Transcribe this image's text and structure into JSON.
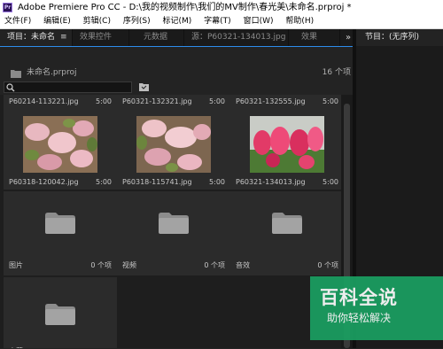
{
  "app": {
    "title": "Adobe Premiere Pro CC - D:\\我的视频制作\\我们的MV制作\\春光美\\未命名.prproj *",
    "icon": "premiere-pro-icon"
  },
  "menu": [
    "文件(F)",
    "编辑(E)",
    "剪辑(C)",
    "序列(S)",
    "标记(M)",
    "字幕(T)",
    "窗口(W)",
    "帮助(H)"
  ],
  "tabs": [
    {
      "label": "项目：未命名",
      "menu": "≡"
    },
    {
      "label": "效果控件"
    },
    {
      "label": "元数据"
    },
    {
      "label": "源：P60321-134013.jpg"
    },
    {
      "label": "效果"
    }
  ],
  "overflow": "»",
  "project": {
    "file": "未命名.prproj",
    "count": "16 个项"
  },
  "search": {
    "placeholder": ""
  },
  "grid": {
    "top_row": [
      {
        "name": "P60214-113221.jpg",
        "duration": "5:00"
      },
      {
        "name": "P60321-132321.jpg",
        "duration": "5:00"
      },
      {
        "name": "P60321-132555.jpg",
        "duration": "5:00"
      }
    ],
    "images": [
      {
        "name": "P60318-120042.jpg",
        "duration": "5:00",
        "kind": "pink-blossom-photo"
      },
      {
        "name": "P60318-115741.jpg",
        "duration": "5:00",
        "kind": "pink-blossom-photo"
      },
      {
        "name": "P60321-134013.jpg",
        "duration": "5:00",
        "kind": "red-flower-photo"
      }
    ],
    "folders": [
      {
        "name": "图片",
        "count": "0 个项"
      },
      {
        "name": "视频",
        "count": "0 个项"
      },
      {
        "name": "音效",
        "count": "0 个项"
      }
    ],
    "partial_folder": {
      "name": "字幕"
    }
  },
  "right_panel": {
    "tab": "节目：(无序列)"
  },
  "watermark": {
    "title": "百科全说",
    "subtitle": "助你轻松解决"
  },
  "colors": {
    "accent": "#2d8ceb",
    "panel": "#232323",
    "watermark": "#1aa062"
  }
}
